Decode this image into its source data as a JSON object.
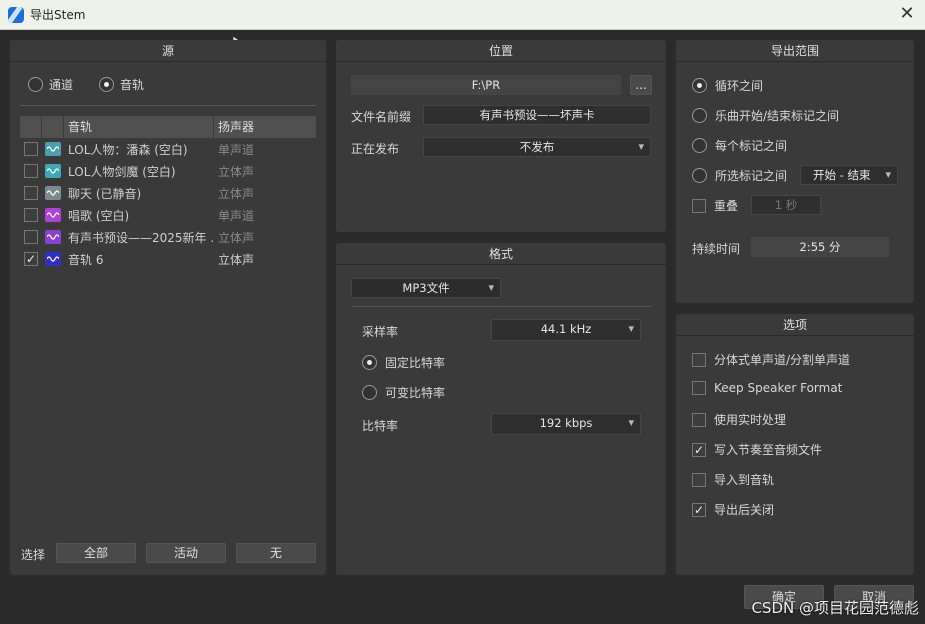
{
  "window": {
    "title": "导出Stem",
    "close_glyph": "✕"
  },
  "source": {
    "header": "源",
    "mode_options": [
      {
        "label": "通道",
        "selected": false
      },
      {
        "label": "音轨",
        "selected": true
      }
    ],
    "columns": {
      "track": "音轨",
      "speaker": "扬声器"
    },
    "tracks": [
      {
        "checked": false,
        "name": "LOL人物：潘森 (空白)",
        "speaker": "单声道",
        "icon_color": "#4aa0b0"
      },
      {
        "checked": false,
        "name": "LOL人物剑魔 (空白)",
        "speaker": "立体声",
        "icon_color": "#3fa8b8"
      },
      {
        "checked": false,
        "name": "聊天 (已静音)",
        "speaker": "立体声",
        "icon_color": "#7a8a90"
      },
      {
        "checked": false,
        "name": "唱歌 (空白)",
        "speaker": "单声道",
        "icon_color": "#b040d8"
      },
      {
        "checked": false,
        "name": "有声书预设——2025新年 ...",
        "speaker": "立体声",
        "icon_color": "#8a40d0"
      },
      {
        "checked": true,
        "name": "音轨 6",
        "speaker": "立体声",
        "icon_color": "#3030c8"
      }
    ],
    "select_label": "选择",
    "select_buttons": {
      "all": "全部",
      "active": "活动",
      "none": "无"
    }
  },
  "location": {
    "header": "位置",
    "path": "F:\\PR",
    "browse_label": "...",
    "prefix_label": "文件名前缀",
    "prefix_value": "有声书预设——坏声卡",
    "publishing_label": "正在发布",
    "publishing_value": "不发布"
  },
  "format": {
    "header": "格式",
    "type_value": "MP3文件",
    "sample_rate_label": "采样率",
    "sample_rate_value": "44.1 kHz",
    "bitrate_modes": [
      {
        "label": "固定比特率",
        "selected": true
      },
      {
        "label": "可变比特率",
        "selected": false
      }
    ],
    "bitrate_label": "比特率",
    "bitrate_value": "192 kbps"
  },
  "range": {
    "header": "导出范围",
    "options": [
      {
        "label": "循环之间",
        "selected": true
      },
      {
        "label": "乐曲开始/结束标记之间",
        "selected": false
      },
      {
        "label": "每个标记之间",
        "selected": false
      },
      {
        "label": "所选标记之间",
        "selected": false
      }
    ],
    "marker_select_value": "开始 - 结束",
    "overlap_label": "重叠",
    "overlap_value": "1 秒",
    "duration_label": "持续时间",
    "duration_value": "2:55 分"
  },
  "options": {
    "header": "选项",
    "items": [
      {
        "label": "分体式单声道/分割单声道",
        "checked": false
      },
      {
        "label": "Keep Speaker Format",
        "checked": false
      },
      {
        "label": "使用实时处理",
        "checked": false
      },
      {
        "label": "写入节奏至音频文件",
        "checked": true
      },
      {
        "label": "导入到音轨",
        "checked": false
      },
      {
        "label": "导出后关闭",
        "checked": true
      }
    ]
  },
  "footer": {
    "ok_label": "确定",
    "cancel_label": "取消"
  },
  "watermark": "CSDN @项目花园范德彪",
  "colors": {
    "panel": "#3a3a3a",
    "background": "#2b2b2b",
    "titlebar": "#eef2e8"
  }
}
